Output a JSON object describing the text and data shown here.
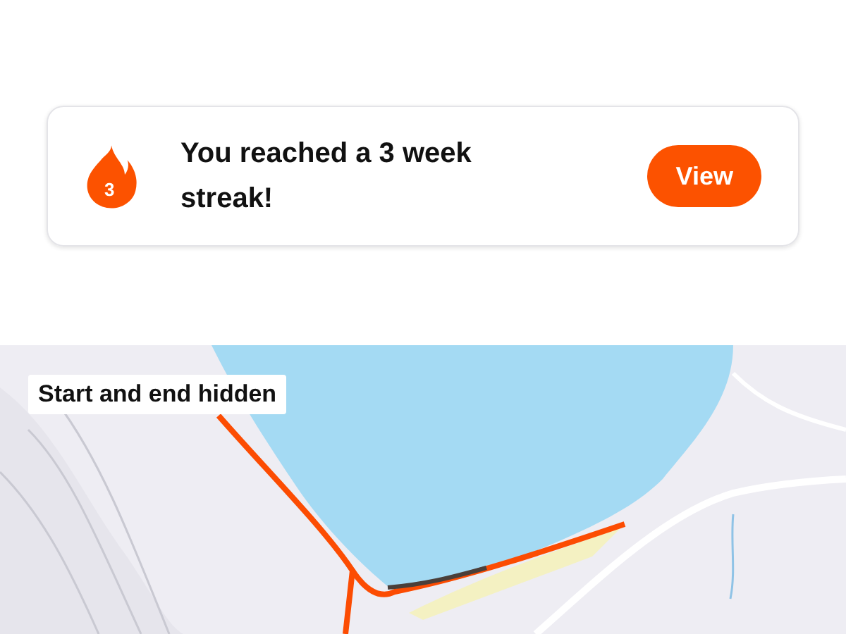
{
  "streak_card": {
    "badge_count": "3",
    "message": "You reached a 3 week streak!",
    "button": "View"
  },
  "map": {
    "label": "Start and end hidden"
  }
}
